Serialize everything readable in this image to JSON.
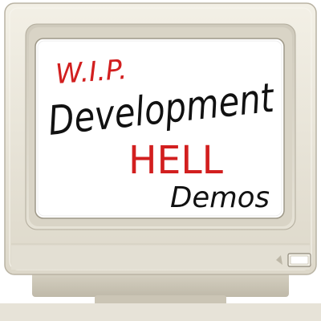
{
  "screen": {
    "lines": [
      {
        "text": "W.I.P.",
        "color": "#d21f1f"
      },
      {
        "text": "Development",
        "color": "#111111"
      },
      {
        "text": "HELL",
        "color": "#d21f1f"
      },
      {
        "text": "Demos",
        "color": "#111111"
      }
    ]
  },
  "colors": {
    "bezel": "#e9e5d9",
    "bezel_shadow": "#c9c4b5",
    "screen_bg": "#ffffff",
    "ink_red": "#d21f1f",
    "ink_black": "#111111"
  },
  "icons": {
    "power_button": "power-button-icon",
    "power_led": "power-led-icon"
  }
}
